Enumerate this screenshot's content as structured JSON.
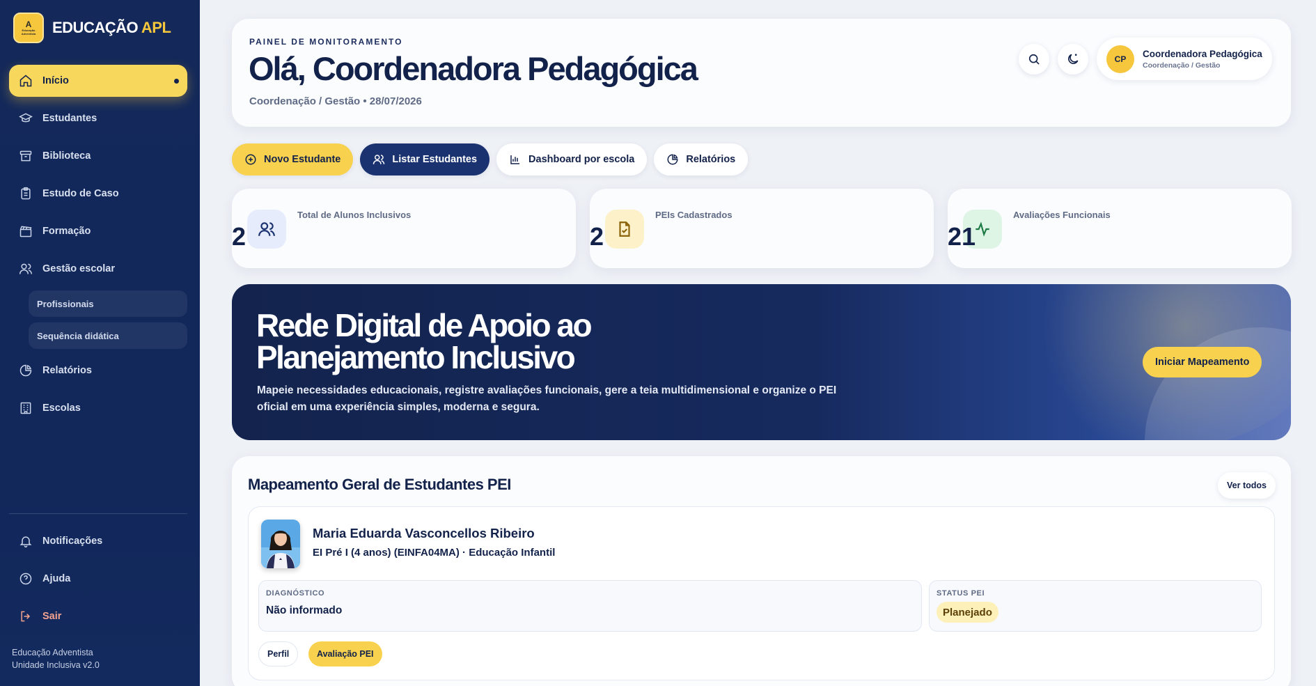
{
  "brand": {
    "logo_line1": "A",
    "logo_line2": "Educação Adventista",
    "name_main": "EDUCAÇÃO",
    "name_accent": "APL"
  },
  "sidebar": {
    "items": [
      {
        "label": "Início",
        "icon": "home-icon",
        "active": true
      },
      {
        "label": "Estudantes",
        "icon": "graduation-cap-icon"
      },
      {
        "label": "Biblioteca",
        "icon": "archive-icon"
      },
      {
        "label": "Estudo de Caso",
        "icon": "clipboard-icon"
      },
      {
        "label": "Formação",
        "icon": "clapperboard-icon"
      },
      {
        "label": "Gestão escolar",
        "icon": "users-icon"
      }
    ],
    "sub_items": [
      {
        "label": "Profissionais"
      },
      {
        "label": "Sequência didática"
      }
    ],
    "items_after": [
      {
        "label": "Relatórios",
        "icon": "pie-chart-icon"
      },
      {
        "label": "Escolas",
        "icon": "building-icon"
      }
    ],
    "bottom_items": [
      {
        "label": "Notificações",
        "icon": "bell-icon"
      },
      {
        "label": "Ajuda",
        "icon": "help-circle-icon"
      },
      {
        "label": "Sair",
        "icon": "logout-icon"
      }
    ],
    "footer_line1": "Educação Adventista",
    "footer_line2": "Unidade Inclusiva v2.0"
  },
  "header": {
    "eyebrow": "PAINEL DE MONITORAMENTO",
    "greeting": "Olá, Coordenadora Pedagógica",
    "subtitle": "Coordenação / Gestão • 28/07/2026",
    "user": {
      "initials": "CP",
      "name": "Coordenadora Pedagógica",
      "role": "Coordenação / Gestão"
    }
  },
  "actions": [
    {
      "label": "Novo Estudante",
      "icon": "plus-circle-icon",
      "style": "yellow"
    },
    {
      "label": "Listar Estudantes",
      "icon": "users-icon",
      "style": "navy"
    },
    {
      "label": "Dashboard por escola",
      "icon": "bar-chart-icon",
      "style": "white"
    },
    {
      "label": "Relatórios",
      "icon": "pie-chart-icon",
      "style": "white"
    }
  ],
  "stats": [
    {
      "label": "Total de Alunos Inclusivos",
      "value": "2",
      "icon": "users-icon",
      "bg": "#e6ecfb",
      "color": "#1a3270"
    },
    {
      "label": "PEIs Cadastrados",
      "value": "2",
      "icon": "file-check-icon",
      "bg": "#fdf1c9",
      "color": "#8a6208"
    },
    {
      "label": "Avaliações Funcionais",
      "value": "21",
      "icon": "activity-icon",
      "bg": "#def5e6",
      "color": "#1e7b45"
    }
  ],
  "hero": {
    "title": "Rede Digital de Apoio ao Planejamento Inclusivo",
    "description": "Mapeie necessidades educacionais, registre avaliações funcionais, gere a teia multidimensional e organize o PEI oficial em uma experiência simples, moderna e segura.",
    "button": "Iniciar Mapeamento"
  },
  "mapping": {
    "title": "Mapeamento Geral de Estudantes PEI",
    "see_all": "Ver todos",
    "student": {
      "name": "Maria Eduarda Vasconcellos Ribeiro",
      "class_info": "EI Pré I (4 anos) (EINFA04MA) · Educação Infantil",
      "diagnosis_label": "DIAGNÓSTICO",
      "diagnosis_value": "Não informado",
      "status_label": "STATUS PEI",
      "status_value": "Planejado",
      "profile_button": "Perfil",
      "evaluation_button": "Avaliação PEI"
    }
  },
  "colors": {
    "navy": "#14295a",
    "yellow": "#f8d14e",
    "background": "#eef1f6"
  }
}
